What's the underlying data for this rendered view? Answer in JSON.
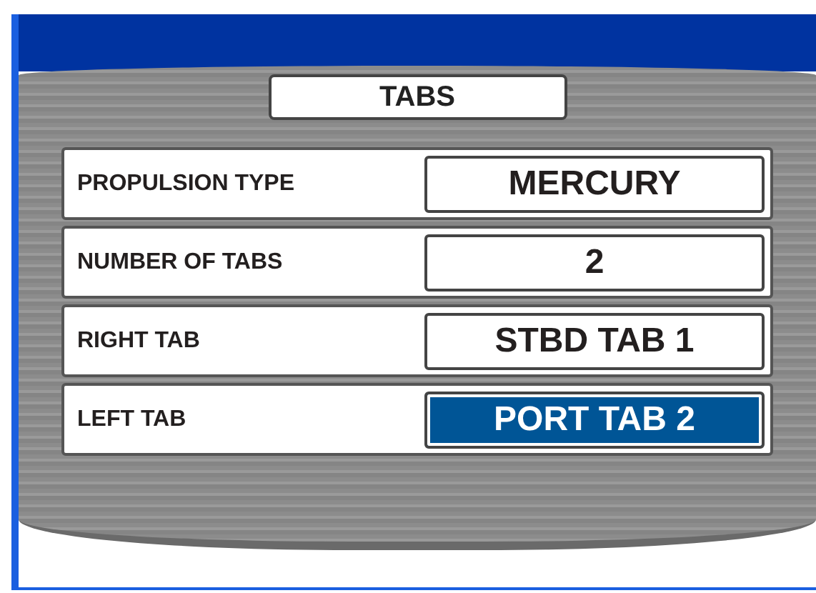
{
  "title": "TABS",
  "rows": [
    {
      "label": "PROPULSION  TYPE",
      "value": "MERCURY",
      "selected": false
    },
    {
      "label": "NUMBER OF TABS",
      "value": "2",
      "selected": false
    },
    {
      "label": "RIGHT TAB",
      "value": "STBD TAB 1",
      "selected": false
    },
    {
      "label": "LEFT TAB",
      "value": "PORT TAB 2",
      "selected": true
    }
  ]
}
